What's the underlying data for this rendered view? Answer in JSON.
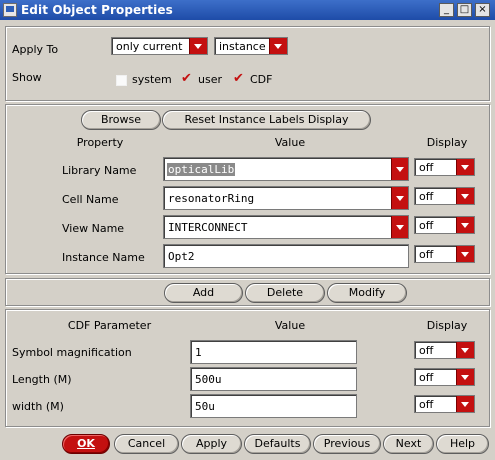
{
  "window": {
    "title": "Edit Object Properties",
    "controls": [
      "_",
      "□",
      "×"
    ]
  },
  "apply_to": {
    "label": "Apply To",
    "scope": "only current",
    "target": "instance"
  },
  "show": {
    "label": "Show",
    "options": [
      {
        "label": "system",
        "checked": false
      },
      {
        "label": "user",
        "checked": true
      },
      {
        "label": "CDF",
        "checked": true
      }
    ]
  },
  "properties": {
    "browse_label": "Browse",
    "reset_label": "Reset Instance Labels Display",
    "headers": {
      "property": "Property",
      "value": "Value",
      "display": "Display"
    },
    "rows": [
      {
        "label": "Library Name",
        "value": "opticalLib",
        "display": "off"
      },
      {
        "label": "Cell Name",
        "value": "resonatorRing",
        "display": "off"
      },
      {
        "label": "View Name",
        "value": "INTERCONNECT",
        "display": "off"
      },
      {
        "label": "Instance Name",
        "value": "Opt2",
        "display": "off"
      }
    ],
    "add_label": "Add",
    "delete_label": "Delete",
    "modify_label": "Modify"
  },
  "cdf": {
    "headers": {
      "parameter": "CDF Parameter",
      "value": "Value",
      "display": "Display"
    },
    "rows": [
      {
        "label": "Symbol magnification",
        "value": "1",
        "display": "off"
      },
      {
        "label": "Length (M)",
        "value": "500u",
        "display": "off"
      },
      {
        "label": "width (M)",
        "value": "50u",
        "display": "off"
      }
    ]
  },
  "buttons": {
    "ok": "OK",
    "cancel": "Cancel",
    "apply": "Apply",
    "defaults": "Defaults",
    "previous": "Previous",
    "next": "Next",
    "help": "Help"
  },
  "colors": {
    "title_bar": "#2a5bbd",
    "accent": "#c41010",
    "window_bg": "#d4d0c8"
  }
}
